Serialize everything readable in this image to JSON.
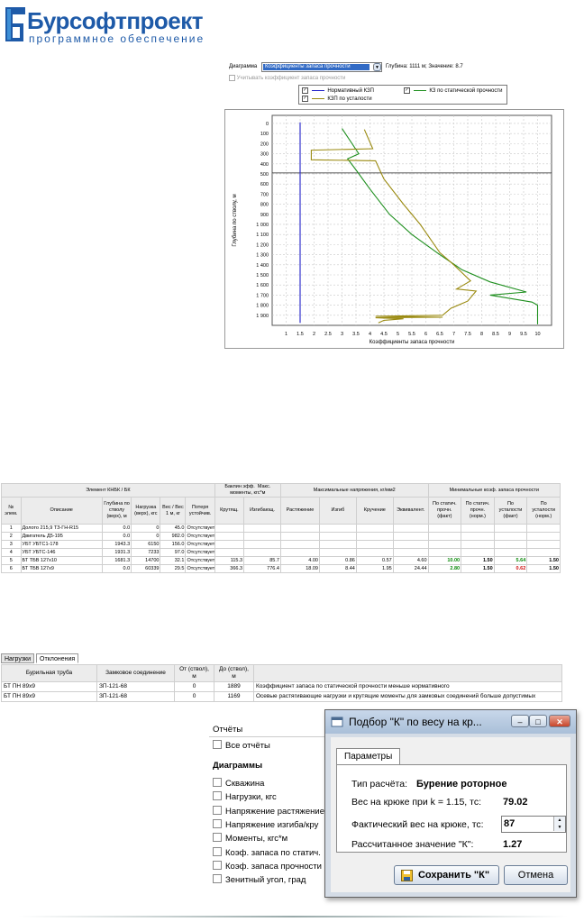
{
  "logo": {
    "title": "Бурсофтпроект",
    "subtitle": "программное обеспечение",
    "colors": {
      "brand": "#1e5aa8",
      "accent": "#3d8fd6"
    }
  },
  "diagram_panel": {
    "label": "Диаграмма",
    "selected": "Коэффициенты запаса прочности",
    "readout": "Глубина: 1111 м; Значение: 8.7",
    "checkbox_label": "Учитывать коэффициент запаса прочности",
    "legend": [
      {
        "label": "Нормативный КЗП",
        "checked": true,
        "color": "#2020c8"
      },
      {
        "label": "КЗ по статической прочности",
        "checked": true,
        "color": "#1f8f1f"
      },
      {
        "label": "КЗП по усталости",
        "checked": true,
        "color": "#9a8a10"
      }
    ]
  },
  "chart_data": {
    "type": "line",
    "xlabel": "Коэффициенты запаса прочности",
    "ylabel": "Глубина по стволу, м",
    "xlim": [
      0.5,
      10.5
    ],
    "ylim": [
      2000,
      -80
    ],
    "x_ticks": [
      "1",
      "1.5",
      "2",
      "2.5",
      "3",
      "3.5",
      "4",
      "4.5",
      "5",
      "5.5",
      "6",
      "6.5",
      "7",
      "7.5",
      "8",
      "8.5",
      "9",
      "9.5",
      "10"
    ],
    "y_ticks": [
      "0",
      "100",
      "200",
      "300",
      "400",
      "500",
      "600",
      "700",
      "800",
      "900",
      "1 000",
      "1 100",
      "1 200",
      "1 300",
      "1 400",
      "1 500",
      "1 600",
      "1 700",
      "1 800",
      "1 900"
    ],
    "grid": true,
    "hline_depth": 490,
    "series": [
      {
        "name": "Нормативный КЗП",
        "color": "#2020c8",
        "points": [
          [
            1.5,
            -10
          ],
          [
            1.5,
            1975
          ]
        ]
      },
      {
        "name": "КЗ по статической прочности",
        "color": "#1f8f1f",
        "points": [
          [
            3.0,
            50
          ],
          [
            3.6,
            300
          ],
          [
            3.2,
            350
          ],
          [
            3.5,
            460
          ],
          [
            4.0,
            650
          ],
          [
            4.7,
            900
          ],
          [
            5.5,
            1100
          ],
          [
            6.5,
            1300
          ],
          [
            7.3,
            1450
          ],
          [
            8.3,
            1570
          ],
          [
            9.6,
            1670
          ],
          [
            8.3,
            1700
          ],
          [
            9.8,
            1770
          ],
          [
            10.0,
            1800
          ],
          [
            10.0,
            1990
          ]
        ]
      },
      {
        "name": "КЗП по усталости",
        "color": "#9a8a10",
        "points": [
          [
            3.8,
            60
          ],
          [
            4.1,
            250
          ],
          [
            1.9,
            265
          ],
          [
            1.9,
            360
          ],
          [
            4.2,
            370
          ],
          [
            4.5,
            550
          ],
          [
            5.2,
            800
          ],
          [
            5.8,
            1000
          ],
          [
            6.5,
            1280
          ],
          [
            7.0,
            1400
          ],
          [
            7.6,
            1560
          ],
          [
            7.1,
            1640
          ],
          [
            7.8,
            1660
          ],
          [
            7.5,
            1760
          ],
          [
            6.9,
            1830
          ],
          [
            6.6,
            1900
          ],
          [
            4.2,
            1910
          ],
          [
            6.6,
            1920
          ],
          [
            4.2,
            1925
          ],
          [
            5.2,
            1935
          ],
          [
            4.5,
            1950
          ],
          [
            4.3,
            1975
          ]
        ]
      }
    ]
  },
  "knbk_table": {
    "groups": [
      "Элемент КНБК / БК",
      "Баклин эфф.",
      "Макс. моменты, кгс*м",
      "Максимальные напряжения, кг/мм2",
      "Минимальные коэф. запаса прочности"
    ],
    "columns": [
      "№ элем.",
      "Описание",
      "Глубина по стволу (верх), м",
      "Нагрузка (верх), кгс",
      "Вес / Вес 1 м, кг",
      "Потеря устойчив.",
      "Крутящ.",
      "Изгибающ.",
      "Растяжение",
      "Изгиб",
      "Кручение",
      "Эквивалент.",
      "По статич. прочн. (факт)",
      "По статич. прочн. (норм.)",
      "По усталости (факт)",
      "По усталости (норм.)"
    ],
    "rows": [
      [
        "1",
        "Долото 215,9 ТЗ-ГН-R15",
        "0.0",
        "0",
        "45.0",
        "Отсутствует",
        "",
        "",
        "",
        "",
        "",
        "",
        "",
        "",
        "",
        ""
      ],
      [
        "2",
        "Двигатель Д5-195",
        "0.0",
        "0",
        "982.0",
        "Отсутствует",
        "",
        "",
        "",
        "",
        "",
        "",
        "",
        "",
        "",
        ""
      ],
      [
        "3",
        "УБТ УБТС1-178",
        "1943.3",
        "6150",
        "156.0",
        "Отсутствует",
        "",
        "",
        "",
        "",
        "",
        "",
        "",
        "",
        "",
        ""
      ],
      [
        "4",
        "УБТ УБТС-146",
        "1931.3",
        "7233",
        "97.0",
        "Отсутствует",
        "",
        "",
        "",
        "",
        "",
        "",
        "",
        "",
        "",
        ""
      ],
      [
        "5",
        "БТ ТБВ 127х10",
        "1681.3",
        "14700",
        "32.1",
        "Отсутствует",
        "115.3",
        "85.7",
        "4.00",
        "0.86",
        "0.57",
        "4.60",
        "10.00",
        "1.50",
        "5.64",
        "1.50"
      ],
      [
        "6",
        "БТ ТБВ 127х9",
        "0.0",
        "60339",
        "29.5",
        "Отсутствует",
        "366.3",
        "776.4",
        "18.09",
        "8.44",
        "1.95",
        "24.44",
        "2.80",
        "1.50",
        "0.62",
        "1.50"
      ]
    ]
  },
  "deviations": {
    "tabs": [
      "Нагрузки",
      "Отклонения"
    ],
    "active_tab": "Отклонения",
    "columns": [
      "Бурильная труба",
      "Замковое соединение",
      "От (ствол), м",
      "До (ствол), м",
      ""
    ],
    "rows": [
      [
        "БТ ПН 89х9",
        "ЗП-121-68",
        "0",
        "1889",
        "Коэффициент запаса по статической прочности меньше нормативного"
      ],
      [
        "БТ ПН 89х9",
        "ЗП-121-68",
        "0",
        "1169",
        "Осевые растягивающие нагрузки и крутящие моменты для замковых соединений больше допустимых"
      ]
    ]
  },
  "reports": {
    "title": "Отчёты",
    "all_reports": "Все отчёты",
    "diagrams_title": "Диаграммы",
    "items": [
      "Скважина",
      "Нагрузки, кгс",
      "Напряжение растяжение",
      "Напряжение изгиба/кру",
      "Моменты, кгс*м",
      "Коэф. запаса по статич.",
      "Коэф. запаса прочности",
      "Зенитный угол, град"
    ]
  },
  "dialog": {
    "title": "Подбор \"К\" по весу на кр...",
    "tab": "Параметры",
    "calc_type_label": "Тип расчёта:",
    "calc_type_value": "Бурение роторное",
    "hook_weight_label": "Вес на крюке при k = 1.15, тс:",
    "hook_weight_value": "79.02",
    "actual_weight_label": "Фактический вес на крюке, тс:",
    "actual_weight_value": "87",
    "k_label": "Рассчитанное значение \"К\":",
    "k_value": "1.27",
    "save_label": "Сохранить \"К\"",
    "cancel_label": "Отмена"
  }
}
